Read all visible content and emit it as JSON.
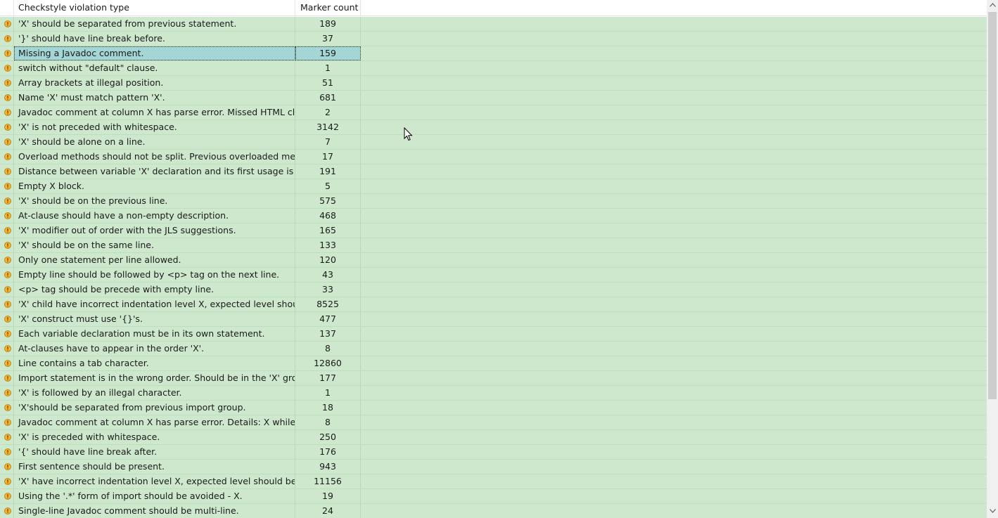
{
  "table": {
    "columns": {
      "type": "Checkstyle violation type",
      "count": "Marker count"
    },
    "selected_index": 2,
    "rows": [
      {
        "type": "'X' should be separated from previous statement.",
        "count": "189"
      },
      {
        "type": "'}' should have line break before.",
        "count": "37"
      },
      {
        "type": "Missing a Javadoc comment.",
        "count": "159"
      },
      {
        "type": "switch without \"default\" clause.",
        "count": "1"
      },
      {
        "type": "Array brackets at illegal position.",
        "count": "51"
      },
      {
        "type": "Name 'X' must match pattern 'X'.",
        "count": "681"
      },
      {
        "type": "Javadoc comment at column X has parse error. Missed HTML cl...",
        "count": "2"
      },
      {
        "type": "'X' is not preceded with whitespace.",
        "count": "3142"
      },
      {
        "type": "'X' should be alone on a line.",
        "count": "7"
      },
      {
        "type": "Overload methods should not be split. Previous overloaded met...",
        "count": "17"
      },
      {
        "type": "Distance between variable 'X' declaration and its first usage is X,...",
        "count": "191"
      },
      {
        "type": "Empty X block.",
        "count": "5"
      },
      {
        "type": "'X' should be on the previous line.",
        "count": "575"
      },
      {
        "type": "At-clause should have a non-empty description.",
        "count": "468"
      },
      {
        "type": "'X' modifier out of order with the JLS suggestions.",
        "count": "165"
      },
      {
        "type": "'X' should be on the same line.",
        "count": "133"
      },
      {
        "type": "Only one statement per line allowed.",
        "count": "120"
      },
      {
        "type": "Empty line should be followed by <p> tag on the next line.",
        "count": "43"
      },
      {
        "type": "<p> tag should be precede with empty line.",
        "count": "33"
      },
      {
        "type": "'X' child have incorrect indentation level X, expected level should...",
        "count": "8525"
      },
      {
        "type": "'X' construct must use '{}'s.",
        "count": "477"
      },
      {
        "type": "Each variable declaration must be in its own statement.",
        "count": "137"
      },
      {
        "type": "At-clauses have to appear in the order 'X'.",
        "count": "8"
      },
      {
        "type": "Line contains a tab character.",
        "count": "12860"
      },
      {
        "type": "Import statement is in the wrong order. Should be in the 'X' gro...",
        "count": "177"
      },
      {
        "type": "'X' is followed by an illegal character.",
        "count": "1"
      },
      {
        "type": "'X'should be separated from previous import group.",
        "count": "18"
      },
      {
        "type": "Javadoc comment at column X has parse error. Details: X while ...",
        "count": "8"
      },
      {
        "type": "'X' is preceded with whitespace.",
        "count": "250"
      },
      {
        "type": "'{' should have line break after.",
        "count": "176"
      },
      {
        "type": "First sentence should be present.",
        "count": "943"
      },
      {
        "type": "'X' have incorrect indentation level X, expected level should be X.",
        "count": "11156"
      },
      {
        "type": "Using the '.*' form of import should be avoided - X.",
        "count": "19"
      },
      {
        "type": "Single-line Javadoc comment should be multi-line.",
        "count": "24"
      }
    ]
  },
  "icons": {
    "row": "warning-icon",
    "scroll_up": "chevron-up-icon",
    "scroll_down": "chevron-down-icon",
    "cursor": "mouse-cursor-icon"
  },
  "colors": {
    "row_background": "#cee8ce",
    "selected_background": "#a5d6d6",
    "warning_fill": "#f5b32a"
  }
}
